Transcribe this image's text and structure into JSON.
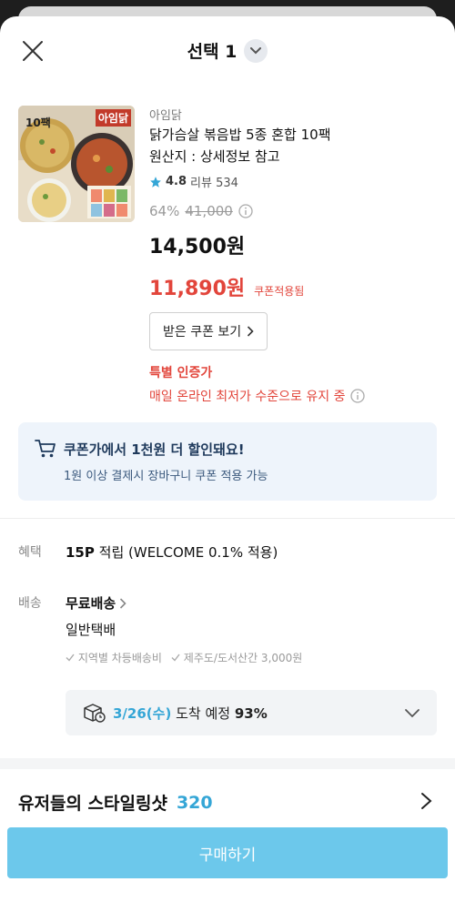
{
  "header": {
    "title": "선택 1"
  },
  "product": {
    "brand": "아임닭",
    "name_line1": "닭가슴살 볶음밥 5종 혼합 10팩",
    "name_line2": "원산지 : 상세정보 참고",
    "rating": "4.8",
    "review_label": "리뷰 534",
    "discount_pct": "64%",
    "original_price": "41,000",
    "price": "14,500원",
    "coupon_price": "11,890원",
    "coupon_applied_label": "쿠폰적용됨",
    "coupon_button": "받은 쿠폰 보기",
    "special_title": "특별 인증가",
    "special_desc": "매일 온라인 최저가 수준으로 유지 중",
    "thumb_badge": "10팩",
    "thumb_logo": "아임닭"
  },
  "banner": {
    "title": "쿠폰가에서 1천원 더 할인돼요!",
    "sub": "1원 이상 결제시 장바구니 쿠폰 적용 가능"
  },
  "benefit": {
    "label": "혜택",
    "points": "15P",
    "rest": " 적립 (WELCOME 0.1% 적용)"
  },
  "shipping": {
    "label": "배송",
    "free": "무료배송",
    "type": "일반택배",
    "note1": "지역별 차등배송비",
    "note2": "제주도/도서산간 3,000원",
    "date": "3/26(수)",
    "arrive": " 도착 예정 ",
    "pct": "93%"
  },
  "styling": {
    "title": "유저들의 스타일링샷",
    "count": "320"
  },
  "buy_button": "구매하기",
  "colors": {
    "accent": "#35a6d6",
    "sale": "#e2453b",
    "buy": "#6cc8eb"
  }
}
